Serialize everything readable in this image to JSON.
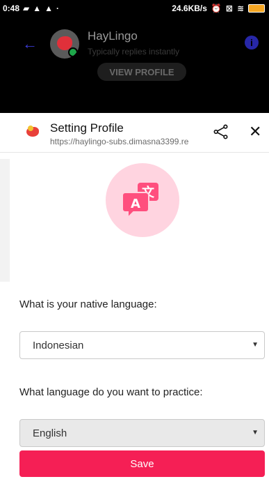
{
  "status_bar": {
    "time": "0:48",
    "speed": "24.6KB/s",
    "icons": [
      "message-icon",
      "warning-icon",
      "warning-icon",
      "dot-icon",
      "alarm-icon",
      "sim-icon",
      "wifi-icon",
      "battery-icon"
    ]
  },
  "chat": {
    "name": "HayLingo",
    "subtitle": "Typically replies instantly",
    "view_profile": "VIEW PROFILE"
  },
  "sheet": {
    "title": "Setting Profile",
    "url": "https://haylingo-subs.dimasna3399.re..."
  },
  "form": {
    "native_label": "What is your native language:",
    "native_value": "Indonesian",
    "practice_label": "What language do you want to practice:",
    "practice_value": "English",
    "save_label": "Save"
  },
  "colors": {
    "accent": "#f51f55",
    "hero_bg": "#ffd4e0",
    "translate_icon": "#ff4f7e"
  }
}
